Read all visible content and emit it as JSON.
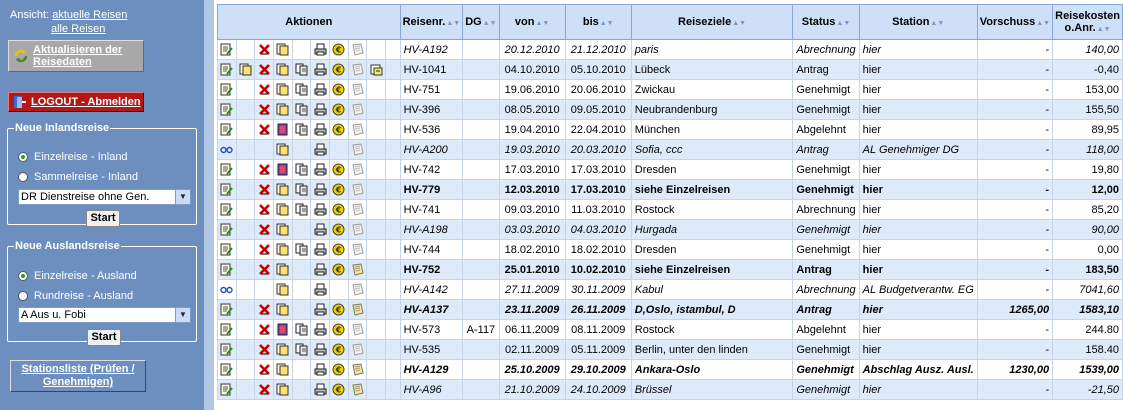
{
  "sidebar": {
    "ansicht_label": "Ansicht:",
    "view_current": "aktuelle Reisen",
    "view_all": "alle Reisen",
    "refresh_label": "Aktualisieren der Reisedaten",
    "logout_label": "LOGOUT - Abmelden",
    "inland": {
      "legend": "Neue Inlandsreise",
      "option1": "Einzelreise - Inland",
      "option2": "Sammelreise - Inland",
      "selected": "DR Dienstreise ohne Gen.",
      "start": "Start"
    },
    "ausland": {
      "legend": "Neue Auslandsreise",
      "option1": "Einzelreise - Ausland",
      "option2": "Rundreise - Ausland",
      "selected": "A Aus u. Fobi",
      "start": "Start"
    },
    "station_label": "Stationsliste (Prüfen / Genehmigen)"
  },
  "table": {
    "headers": {
      "aktionen": "Aktionen",
      "reisenr": "Reisenr.",
      "dg": "DG",
      "von": "von",
      "bis": "bis",
      "reiseziele": "Reiseziele",
      "status": "Status",
      "station": "Station",
      "vorschuss": "Vorschuss",
      "reisekosten": "Reisekosten o.Anr."
    },
    "rows": [
      {
        "nr": "HV-A192",
        "dg": "",
        "von": "20.12.2010",
        "bis": "21.12.2010",
        "ziel": "paris",
        "status": "Abrechnung",
        "station": "hier",
        "vorschuss": "-",
        "kosten": "140,00"
      },
      {
        "nr": "HV-1041",
        "dg": "",
        "von": "04.10.2010",
        "bis": "05.10.2010",
        "ziel": "Lübeck",
        "status": "Antrag",
        "station": "hier",
        "vorschuss": "-",
        "kosten": "-0,40"
      },
      {
        "nr": "HV-751",
        "dg": "",
        "von": "19.06.2010",
        "bis": "20.06.2010",
        "ziel": "Zwickau",
        "status": "Genehmigt",
        "station": "hier",
        "vorschuss": "-",
        "kosten": "153,00"
      },
      {
        "nr": "HV-396",
        "dg": "",
        "von": "08.05.2010",
        "bis": "09.05.2010",
        "ziel": "Neubrandenburg",
        "status": "Genehmigt",
        "station": "hier",
        "vorschuss": "-",
        "kosten": "155,50"
      },
      {
        "nr": "HV-536",
        "dg": "",
        "von": "19.04.2010",
        "bis": "22.04.2010",
        "ziel": "München",
        "status": "Abgelehnt",
        "station": "hier",
        "vorschuss": "-",
        "kosten": "89,95"
      },
      {
        "nr": "HV-A200",
        "dg": "",
        "von": "19.03.2010",
        "bis": "20.03.2010",
        "ziel": "Sofia, ccc",
        "status": "Antrag",
        "station": "AL Genehmiger DG",
        "vorschuss": "-",
        "kosten": "118,00"
      },
      {
        "nr": "HV-742",
        "dg": "",
        "von": "17.03.2010",
        "bis": "17.03.2010",
        "ziel": "Dresden",
        "status": "Genehmigt",
        "station": "hier",
        "vorschuss": "-",
        "kosten": "19,80"
      },
      {
        "nr": "HV-779",
        "dg": "",
        "von": "12.03.2010",
        "bis": "17.03.2010",
        "ziel": "siehe Einzelreisen",
        "status": "Genehmigt",
        "station": "hier",
        "vorschuss": "-",
        "kosten": "12,00"
      },
      {
        "nr": "HV-741",
        "dg": "",
        "von": "09.03.2010",
        "bis": "11.03.2010",
        "ziel": "Rostock",
        "status": "Abrechnung",
        "station": "hier",
        "vorschuss": "-",
        "kosten": "85,20"
      },
      {
        "nr": "HV-A198",
        "dg": "",
        "von": "03.03.2010",
        "bis": "04.03.2010",
        "ziel": "Hurgada",
        "status": "Genehmigt",
        "station": "hier",
        "vorschuss": "-",
        "kosten": "90,00"
      },
      {
        "nr": "HV-744",
        "dg": "",
        "von": "18.02.2010",
        "bis": "18.02.2010",
        "ziel": "Dresden",
        "status": "Genehmigt",
        "station": "hier",
        "vorschuss": "-",
        "kosten": "0,00"
      },
      {
        "nr": "HV-752",
        "dg": "",
        "von": "25.01.2010",
        "bis": "10.02.2010",
        "ziel": "siehe Einzelreisen",
        "status": "Antrag",
        "station": "hier",
        "vorschuss": "-",
        "kosten": "183,50"
      },
      {
        "nr": "HV-A142",
        "dg": "",
        "von": "27.11.2009",
        "bis": "30.11.2009",
        "ziel": "Kabul",
        "status": "Abrechnung",
        "station": "AL Budgetverantw. EG",
        "vorschuss": "-",
        "kosten": "7041,60"
      },
      {
        "nr": "HV-A137",
        "dg": "",
        "von": "23.11.2009",
        "bis": "26.11.2009",
        "ziel": "D,Oslo, istambul, D",
        "status": "Antrag",
        "station": "hier",
        "vorschuss": "1265,00",
        "kosten": "1583,10"
      },
      {
        "nr": "HV-573",
        "dg": "A-117",
        "von": "06.11.2009",
        "bis": "08.11.2009",
        "ziel": "Rostock",
        "status": "Abgelehnt",
        "station": "hier",
        "vorschuss": "-",
        "kosten": "244.80"
      },
      {
        "nr": "HV-535",
        "dg": "",
        "von": "02.11.2009",
        "bis": "05.11.2009",
        "ziel": "Berlin, unter den linden",
        "status": "Genehmigt",
        "station": "hier",
        "vorschuss": "-",
        "kosten": "158.40"
      },
      {
        "nr": "HV-A129",
        "dg": "",
        "von": "25.10.2009",
        "bis": "29.10.2009",
        "ziel": "Ankara-Oslo",
        "status": "Genehmigt",
        "station": "Abschlag Ausz. Ausl.",
        "vorschuss": "1230,00",
        "kosten": "1539,00"
      },
      {
        "nr": "HV-A96",
        "dg": "",
        "von": "21.10.2009",
        "bis": "24.10.2009",
        "ziel": "Brüssel",
        "status": "Genehmigt",
        "station": "hier",
        "vorschuss": "-",
        "kosten": "-21,50"
      }
    ]
  }
}
